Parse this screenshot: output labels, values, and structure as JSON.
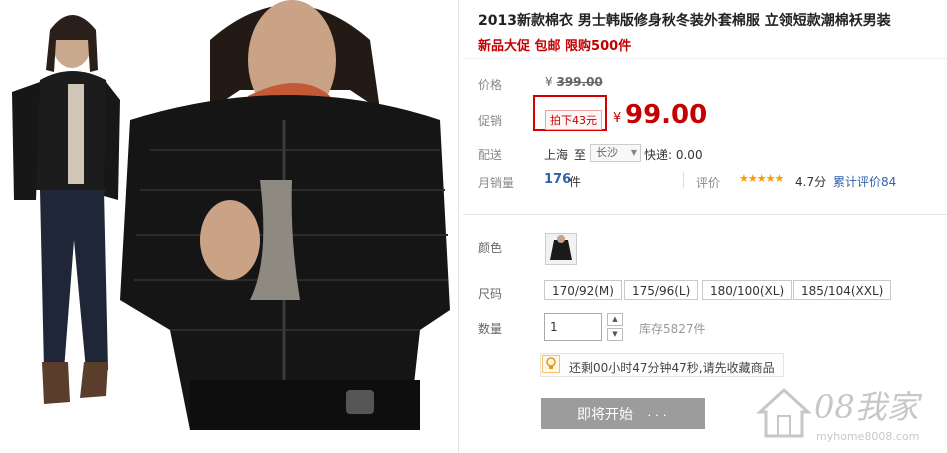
{
  "product": {
    "title": "2013新款棉衣 男士韩版修身秋冬装外套棉服 立领短款潮棉袄男装",
    "subtitle": "新品大促 包邮 限购500件"
  },
  "price": {
    "label": "价格",
    "currency": "¥",
    "original": "399.00"
  },
  "promo": {
    "label": "促销",
    "tag": "拍下43元",
    "currency": "¥",
    "price": "99.00"
  },
  "shipping": {
    "label": "配送",
    "origin": "上海",
    "to": "至",
    "destination": "长沙",
    "express": "快递: 0.00"
  },
  "sales": {
    "label": "月销量",
    "count": "176",
    "unit": "件",
    "rating_label": "评价",
    "stars": "★★★★★",
    "score": "4.7分",
    "reviews_link": "累计评价84"
  },
  "color": {
    "label": "颜色"
  },
  "size": {
    "label": "尺码",
    "options": [
      "170/92(M)",
      "175/96(L)",
      "180/100(XL)",
      "185/104(XXL)"
    ]
  },
  "quantity": {
    "label": "数量",
    "value": "1",
    "stock": "库存5827件"
  },
  "countdown": {
    "text": "还剩00小时47分钟47秒,请先收藏商品"
  },
  "buy_button": {
    "label": "即将开始",
    "dots": "···"
  },
  "watermark": {
    "text": "08我家",
    "url": "myhome8008.com"
  },
  "colors": {
    "accent_red": "#c40000",
    "link_blue": "#2f63a8",
    "button_gray": "#9c9c9c"
  }
}
